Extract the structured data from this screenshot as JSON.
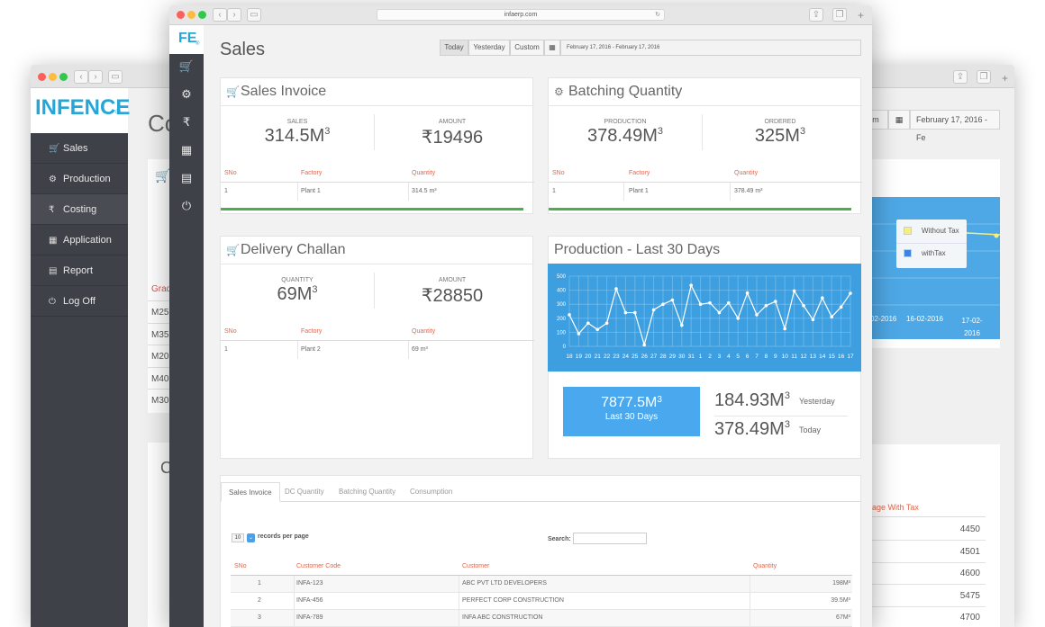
{
  "back_window": {
    "logo_text": "INFENCE",
    "logo_reg": "®",
    "menu": [
      {
        "icon": "cart-icon",
        "glyph": "🛒",
        "label": "Sales"
      },
      {
        "icon": "cogs-icon",
        "glyph": "⚙",
        "label": "Production"
      },
      {
        "icon": "rupee-icon",
        "glyph": "₹",
        "label": "Costing"
      },
      {
        "icon": "grid-icon",
        "glyph": "▦",
        "label": "Application"
      },
      {
        "icon": "report-icon",
        "glyph": "▤",
        "label": "Report"
      },
      {
        "icon": "power-icon",
        "glyph": "⏻",
        "label": "Log Off"
      }
    ],
    "main_title": "Co",
    "grade_header": "Grad",
    "grades": [
      "M25",
      "M35",
      "M20",
      "M40",
      "M30"
    ],
    "second_card_initial": "C",
    "right_header_fragment": "age With Tax",
    "right_values": [
      "4450",
      "4501",
      "4600",
      "5475",
      "4700"
    ],
    "date_button": "m",
    "date_range": "February 17, 2016 - Fe",
    "legend": [
      {
        "label": "Without Tax",
        "color": "#f4f07a"
      },
      {
        "label": "withTax",
        "color": "#3d84e0"
      }
    ],
    "x_ticks": [
      "02-2016",
      "16-02-2016",
      "17-02-\n2016"
    ]
  },
  "front_window": {
    "url": "infaerp.com",
    "logo_text": "FE",
    "logo_reg": "®",
    "sidebar_icons": [
      "cart-icon",
      "cogs-icon",
      "rupee-icon",
      "grid-icon",
      "report-icon",
      "power-icon"
    ],
    "page_title": "Sales",
    "range_buttons": [
      "Today",
      "Yesterday",
      "Custom"
    ],
    "date_range": "February 17, 2016 - February 17, 2016",
    "sales_invoice": {
      "title": "Sales Invoice",
      "left_label": "SALES",
      "left_value": "314.5M",
      "left_sup": "3",
      "right_label": "AMOUNT",
      "right_value": "₹19496",
      "headers": [
        "SNo",
        "Factory",
        "Quantity"
      ],
      "rows": [
        [
          "1",
          "Plant 1",
          "314.5 m³"
        ]
      ]
    },
    "batching_quantity": {
      "title": "Batching Quantity",
      "left_label": "PRODUCTION",
      "left_value": "378.49M",
      "left_sup": "3",
      "right_label": "ORDERED",
      "right_value": "325M",
      "right_sup": "3",
      "headers": [
        "SNo",
        "Factory",
        "Quantity"
      ],
      "rows": [
        [
          "1",
          "Plant 1",
          "378.49 m³"
        ]
      ]
    },
    "delivery_challan": {
      "title": "Delivery Challan",
      "left_label": "QUANTITY",
      "left_value": "69M",
      "left_sup": "3",
      "right_label": "AMOUNT",
      "right_value": "₹28850",
      "headers": [
        "SNo",
        "Factory",
        "Quantity"
      ],
      "rows": [
        [
          "1",
          "Plant 2",
          "69 m³"
        ]
      ]
    },
    "production_30": {
      "title": "Production - Last 30 Days",
      "total_value": "7877.5M",
      "total_sup": "3",
      "total_label": "Last 30 Days",
      "yesterday_value": "184.93M",
      "yesterday_sup": "3",
      "yesterday_label": "Yesterday",
      "today_value": "378.49M",
      "today_sup": "3",
      "today_label": "Today"
    },
    "tabs": [
      "Sales Invoice",
      "DC Quantity",
      "Batching Quantity",
      "Consumption"
    ],
    "records_select": "10",
    "records_label": "records per page",
    "search_label": "Search:",
    "table": {
      "headers": [
        "SNo",
        "Customer Code",
        "Customer",
        "Quantity"
      ],
      "rows": [
        [
          "1",
          "INFA-123",
          "ABC PVT LTD DEVELOPERS",
          "198M³"
        ],
        [
          "2",
          "INFA-456",
          "PERFECT CORP CONSTRUCTION",
          "39.5M³"
        ],
        [
          "3",
          "INFA-789",
          "INFA ABC CONSTRUCTION",
          "67M³"
        ]
      ]
    }
  },
  "chart_data": {
    "type": "line",
    "title": "Production - Last 30 Days",
    "x": [
      "18",
      "19",
      "20",
      "21",
      "22",
      "23",
      "24",
      "25",
      "26",
      "27",
      "28",
      "29",
      "30",
      "31",
      "1",
      "2",
      "3",
      "4",
      "5",
      "6",
      "7",
      "8",
      "9",
      "10",
      "11",
      "12",
      "13",
      "14",
      "15",
      "16",
      "17"
    ],
    "series": [
      {
        "values": [
          225,
          90,
          165,
          120,
          165,
          410,
          240,
          240,
          10,
          260,
          300,
          330,
          150,
          435,
          300,
          310,
          240,
          310,
          200,
          380,
          225,
          290,
          320,
          125,
          395,
          290,
          190,
          345,
          210,
          280,
          378
        ]
      }
    ],
    "ylim": [
      0,
      500
    ],
    "yticks": [
      "500",
      "400",
      "300",
      "200",
      "100",
      "0"
    ],
    "grid": true,
    "color": "#ffffff",
    "background": "#3d9fe0"
  }
}
